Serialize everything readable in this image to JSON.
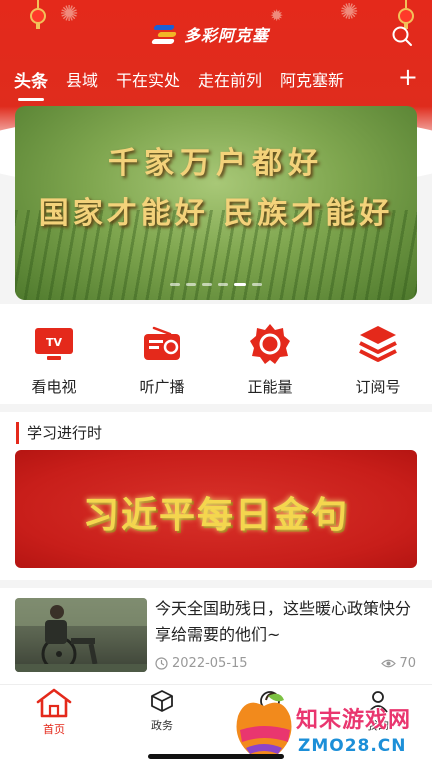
{
  "app": {
    "logo_text": "多彩阿克塞"
  },
  "tabs": [
    {
      "label": "头条"
    },
    {
      "label": "县域"
    },
    {
      "label": "干在实处"
    },
    {
      "label": "走在前列"
    },
    {
      "label": "阿克塞新"
    }
  ],
  "tabs_add_label": "+",
  "banner": {
    "line1": "千家万户都好",
    "line2": "国家才能好 民族才能好",
    "slide_count": 6,
    "active_slide": 5
  },
  "quick_links": [
    {
      "label": "看电视",
      "icon": "tv-icon"
    },
    {
      "label": "听广播",
      "icon": "radio-icon"
    },
    {
      "label": "正能量",
      "icon": "energy-icon"
    },
    {
      "label": "订阅号",
      "icon": "layers-icon"
    }
  ],
  "section": {
    "title": "学习进行时",
    "banner_text": "习近平每日金句"
  },
  "news": {
    "title": "今天全国助残日，这些暖心政策快分享给需要的他们~",
    "date": "2022-05-15",
    "views": "70"
  },
  "bottom_nav": [
    {
      "label": "首页",
      "icon": "home-icon"
    },
    {
      "label": "政务",
      "icon": "gov-icon"
    },
    {
      "label": "",
      "icon": "service-icon"
    },
    {
      "label": "我的",
      "icon": "user-icon"
    }
  ],
  "watermark": {
    "line1": "知末游戏网",
    "line2": "ZMO28.CN"
  },
  "colors": {
    "brand_red": "#e4291b",
    "banner_gold": "#f3d27a"
  }
}
